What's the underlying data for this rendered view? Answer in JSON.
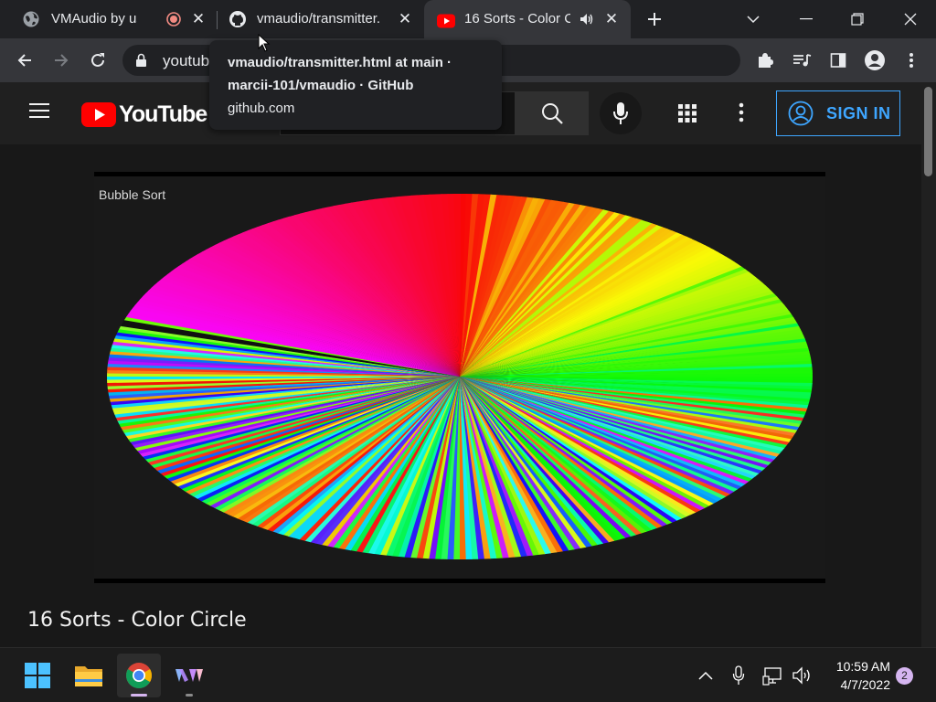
{
  "tabs": [
    {
      "title": "VMAudio by user",
      "favicon": "globe-icon",
      "indicator": "recording-icon"
    },
    {
      "title": "vmaudio/transmitter.h",
      "favicon": "github-icon"
    },
    {
      "title": "16 Sorts - Color C",
      "favicon": "youtube-icon",
      "indicator": "audio-playing-icon"
    }
  ],
  "omnibox": {
    "url": "youtub"
  },
  "tooltip": {
    "line1": "vmaudio/transmitter.html at main ·",
    "line2": "marcii-101/vmaudio · GitHub",
    "line3": "github.com"
  },
  "youtube": {
    "logo_text": "YouTube",
    "sign_in": "SIGN IN",
    "video_label": "Bubble Sort",
    "video_title": "16 Sorts - Color Circle"
  },
  "taskbar": {
    "time": "10:59 AM",
    "date": "4/7/2022",
    "notification_count": "2"
  },
  "colors": {
    "accent": "#3ea6ff",
    "youtube_red": "#ff0000",
    "background": "#181818"
  }
}
